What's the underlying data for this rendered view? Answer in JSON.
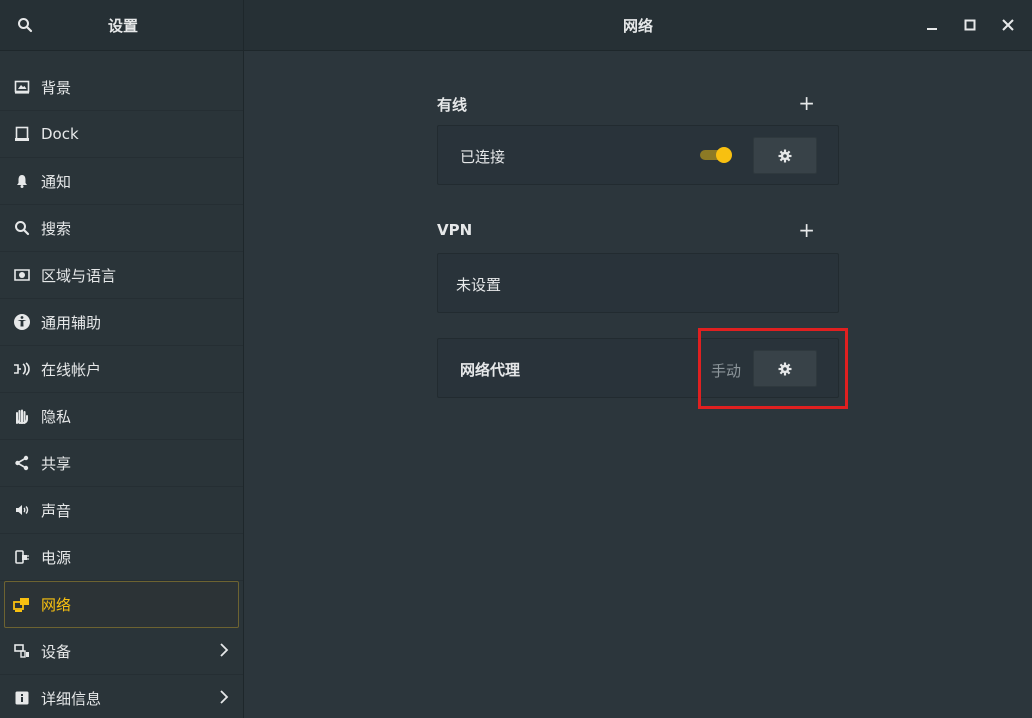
{
  "window": {
    "sidebar_title": "设置",
    "page_title": "网络",
    "controls": [
      "minimize-icon",
      "maximize-icon",
      "close-icon"
    ]
  },
  "sidebar": {
    "items": [
      {
        "label": "背景",
        "icon": "wallpaper-icon"
      },
      {
        "label": "Dock",
        "icon": "dock-icon"
      },
      {
        "label": "通知",
        "icon": "bell-icon"
      },
      {
        "label": "搜索",
        "icon": "search-icon"
      },
      {
        "label": "区域与语言",
        "icon": "region-icon"
      },
      {
        "label": "通用辅助",
        "icon": "accessibility-icon"
      },
      {
        "label": "在线帐户",
        "icon": "online-accounts-icon"
      },
      {
        "label": "隐私",
        "icon": "hand-icon"
      },
      {
        "label": "共享",
        "icon": "share-icon"
      },
      {
        "label": "声音",
        "icon": "speaker-icon"
      },
      {
        "label": "电源",
        "icon": "power-icon"
      },
      {
        "label": "网络",
        "icon": "network-icon",
        "active": true
      },
      {
        "label": "设备",
        "icon": "devices-icon",
        "chevron": true
      },
      {
        "label": "详细信息",
        "icon": "info-icon",
        "chevron": true
      }
    ]
  },
  "main": {
    "wired": {
      "heading": "有线",
      "plus": "+",
      "status": "已连接",
      "toggle_on": true
    },
    "vpn": {
      "heading": "VPN",
      "plus": "+",
      "status": "未设置"
    },
    "proxy": {
      "label": "网络代理",
      "mode": "手动"
    }
  },
  "colors": {
    "accent": "#f8c010",
    "highlight_box": "#e02020",
    "background": "#2c363c"
  }
}
